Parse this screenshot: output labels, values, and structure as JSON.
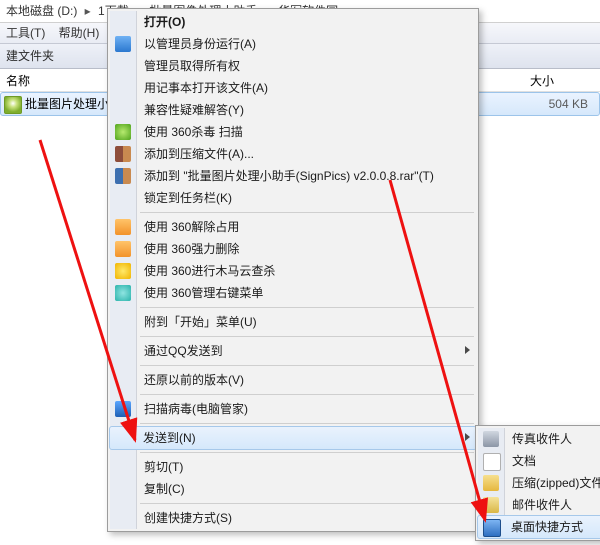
{
  "breadcrumb": {
    "items": [
      "本地磁盘 (D:)",
      "1下载",
      "批量图像处理小助手",
      "华军软件园"
    ]
  },
  "menubar": {
    "tools": "工具(T)",
    "help": "帮助(H)"
  },
  "toolbar": {
    "new_folder": "建文件夹"
  },
  "columns": {
    "name": "名称",
    "size": "大小"
  },
  "files": [
    {
      "name": "批量图片处理小",
      "size": "504 KB"
    }
  ],
  "context_menu": {
    "open": "打开(O)",
    "run_as_admin": "以管理员身份运行(A)",
    "manage_ownership": "管理员取得所有权",
    "open_notepad": "用记事本打开该文件(A)",
    "troubleshoot_compat": "兼容性疑难解答(Y)",
    "scan_360": "使用 360杀毒 扫描",
    "add_to_archive": "添加到压缩文件(A)...",
    "add_to_named_rar": "添加到 \"批量图片处理小助手(SignPics) v2.0.0.8.rar\"(T)",
    "pin_taskbar": "锁定到任务栏(K)",
    "unlock_360": "使用 360解除占用",
    "force_delete_360": "使用 360强力删除",
    "cloud_scan_360": "使用 360进行木马云查杀",
    "rightclick_360": "使用 360管理右键菜单",
    "pin_start": "附到「开始」菜单(U)",
    "qq_send": "通过QQ发送到",
    "restore_prev": "还原以前的版本(V)",
    "scan_guanjia": "扫描病毒(电脑管家)",
    "send_to": "发送到(N)",
    "cut": "剪切(T)",
    "copy": "复制(C)",
    "create_shortcut": "创建快捷方式(S)"
  },
  "send_to_menu": {
    "fax_recipient": "传真收件人",
    "documents": "文档",
    "compressed": "压缩(zipped)文件",
    "mail_recipient": "邮件收件人",
    "desktop_shortcut": "桌面快捷方式"
  }
}
